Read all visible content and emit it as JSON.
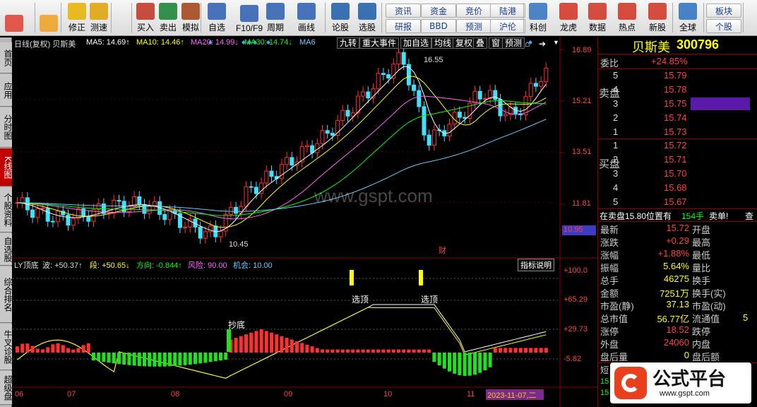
{
  "toolbar": {
    "buttons": [
      {
        "label": "",
        "icon": "grid-icon"
      },
      {
        "label": "",
        "icon": "back-arrow-icon"
      },
      {
        "label": "修正",
        "icon": "up-down-icon"
      },
      {
        "label": "测速",
        "icon": "clock-icon"
      },
      {
        "label": "买入",
        "icon": "buy-icon"
      },
      {
        "label": "卖出",
        "icon": "sell-icon"
      },
      {
        "label": "模拟",
        "icon": "hammer-icon"
      },
      {
        "label": "自选",
        "icon": "star-icon"
      },
      {
        "label": "F10/F9",
        "icon": "f10-icon"
      },
      {
        "label": "周期",
        "icon": "period-icon"
      },
      {
        "label": "画线",
        "icon": "pen-icon"
      },
      {
        "label": "论股",
        "icon": "discuss-icon"
      },
      {
        "label": "选股",
        "icon": "select-icon"
      },
      {
        "label": "科创",
        "icon": "chart-icon"
      },
      {
        "label": "龙虎",
        "icon": "dragon-icon"
      },
      {
        "label": "数据",
        "icon": "pe-icon"
      },
      {
        "label": "热点",
        "icon": "fire-icon"
      },
      {
        "label": "新股",
        "icon": "ipo-icon"
      },
      {
        "label": "全球",
        "icon": "globe-icon"
      }
    ],
    "small": [
      "资讯",
      "研报",
      "资金",
      "BBD",
      "竞价",
      "预测",
      "陆港",
      "沪伦",
      "板块",
      "个股"
    ],
    "sellbuy": {
      "buy": "买",
      "sell": "卖"
    }
  },
  "sidebar": [
    "首页",
    "应用",
    "分时图",
    "K线图",
    "个股资料",
    "自选股",
    "综合排名",
    "牛叉诊股",
    "超级盘"
  ],
  "chart": {
    "header": {
      "period": "日线(复权) 贝斯美",
      "ma5": "MA5: 14.69↑",
      "ma10": "MA10: 14.46↑",
      "ma20": "MA20: 14.99↓",
      "ma30": "MA30: 14.74↓",
      "ma6": "MA6"
    },
    "buttons": [
      "九转",
      "重大事件",
      "加自选",
      "均线",
      "复权",
      "叠",
      "窗",
      "预测"
    ],
    "price_labels": [
      "16.89",
      "15.21",
      "13.51",
      "11.81",
      "10.95"
    ],
    "high_label": "16.55",
    "low_label": "10.45",
    "fin_mark": "财",
    "watermark": "www.gspt.com",
    "indicator": {
      "name": "LY顶底",
      "wave": "波: +50.37↑",
      "seg": "段: +50.65↓",
      "dir": "方向: -0.844↑",
      "risk": "风险: 90.00",
      "chance": "机会: 10.00",
      "help": "指标说明",
      "axis": [
        "+100.0",
        "+65.29",
        "+29.73",
        "-5.82"
      ],
      "top1": "选顶",
      "top2": "选顶",
      "bottom": "抄底"
    },
    "months": [
      "06",
      "07",
      "08",
      "09",
      "10",
      "11"
    ],
    "date_box": "2023-11-07,二"
  },
  "quote": {
    "name": "贝斯美",
    "code": "300796",
    "weibi_label": "委比",
    "weibi": "+24.85%",
    "sell_title": "卖盘",
    "buy_title": "买盘",
    "sell": [
      {
        "n": "5",
        "p": "15.79"
      },
      {
        "n": "4",
        "p": "15.78"
      },
      {
        "n": "3",
        "p": "15.75"
      },
      {
        "n": "2",
        "p": "15.74"
      },
      {
        "n": "1",
        "p": "15.73"
      }
    ],
    "buy": [
      {
        "n": "1",
        "p": "15.72"
      },
      {
        "n": "2",
        "p": "15.71"
      },
      {
        "n": "3",
        "p": "15.70"
      },
      {
        "n": "4",
        "p": "15.68"
      },
      {
        "n": "5",
        "p": "15.67"
      }
    ],
    "notice": "在卖盘15.80位置有",
    "notice_num": "154手",
    "notice_tag": "卖单!",
    "notice_more": "查",
    "stats": [
      {
        "l": "最新",
        "v": "15.72",
        "r": "开盘"
      },
      {
        "l": "涨跌",
        "v": "+0.29",
        "r": "最高"
      },
      {
        "l": "涨幅",
        "v": "+1.88%",
        "r": "最低"
      },
      {
        "l": "振幅",
        "v": "5.64%",
        "r": "量比"
      },
      {
        "l": "总手",
        "v": "46275",
        "r": "换手"
      },
      {
        "l": "金额",
        "v": "7251万",
        "r": "换手(实)"
      },
      {
        "l": "市盈(静)",
        "v": "37.13",
        "r": "市盈(动)"
      },
      {
        "l": "总市值",
        "v": "56.77亿",
        "r": "流通值"
      },
      {
        "l": "涨停",
        "v": "18.52",
        "r": "跌停"
      },
      {
        "l": "外盘",
        "v": "24060",
        "r": "内盘"
      },
      {
        "l": "盘后量",
        "v": "0",
        "r": "盘后额"
      }
    ],
    "flow_text": "短",
    "flow_extra": "5",
    "bottom_nums": [
      "15",
      "15"
    ]
  },
  "logo": {
    "name": "公式平台",
    "url": "www.gspt.com"
  }
}
